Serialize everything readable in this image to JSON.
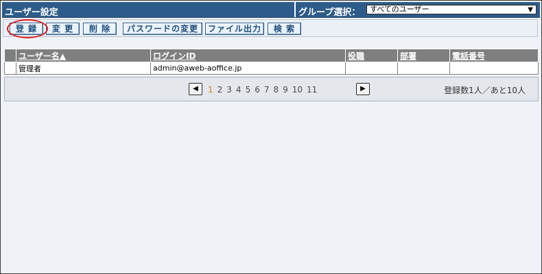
{
  "header": {
    "title": "ユーザー設定",
    "group_label": "グループ選択：",
    "group_selected": "すべてのユーザー"
  },
  "toolbar": {
    "register": "登 録",
    "change": "変 更",
    "delete": "削 除",
    "password_change": "パスワードの変更",
    "file_output": "ファイル出力",
    "search": "検 索"
  },
  "table": {
    "columns": [
      "ユーザー名▲",
      "ログインID",
      "役職",
      "部署",
      "電話番号"
    ],
    "rows": [
      [
        "管理者",
        "admin@aweb-aoffice.jp",
        "",
        "",
        ""
      ]
    ]
  },
  "pager": {
    "prev_icon": "left-arrow-icon",
    "next_icon": "right-arrow-icon",
    "pages": [
      "1",
      "2",
      "3",
      "4",
      "5",
      "6",
      "7",
      "8",
      "9",
      "10",
      "11"
    ],
    "current": "1",
    "summary": "登録数1人／あと10人"
  },
  "colors": {
    "header_bg": "#2d5c8a",
    "table_header_bg": "#7f7f7f",
    "current_page": "#e07a20",
    "highlight": "#e01c1c"
  }
}
